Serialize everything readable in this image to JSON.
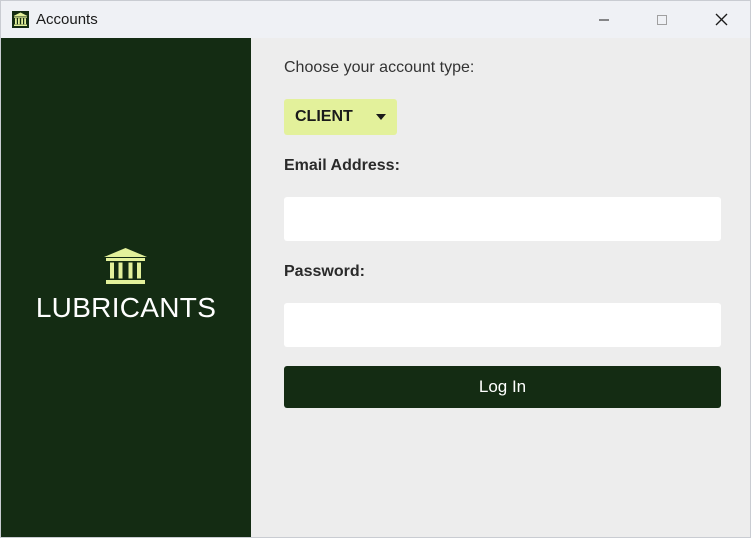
{
  "window": {
    "title": "Accounts",
    "icon": "bank-icon"
  },
  "titlebar_buttons": {
    "minimize_icon": "minimize-icon",
    "maximize_icon": "maximize-icon",
    "close_icon": "close-icon"
  },
  "sidebar": {
    "brand_icon": "bank-icon",
    "brand_name": "LUBRICANTS"
  },
  "form": {
    "account_type_label": "Choose your account type:",
    "account_type_value": "CLIENT",
    "email_label": "Email Address:",
    "email_value": "",
    "password_label": "Password:",
    "password_value": "",
    "login_label": "Log In"
  },
  "colors": {
    "sidebar_bg": "#142c13",
    "accent_select": "#e3f19b",
    "brand_icon": "#e3f19b",
    "form_bg": "#ededed",
    "button_bg": "#142c13"
  }
}
